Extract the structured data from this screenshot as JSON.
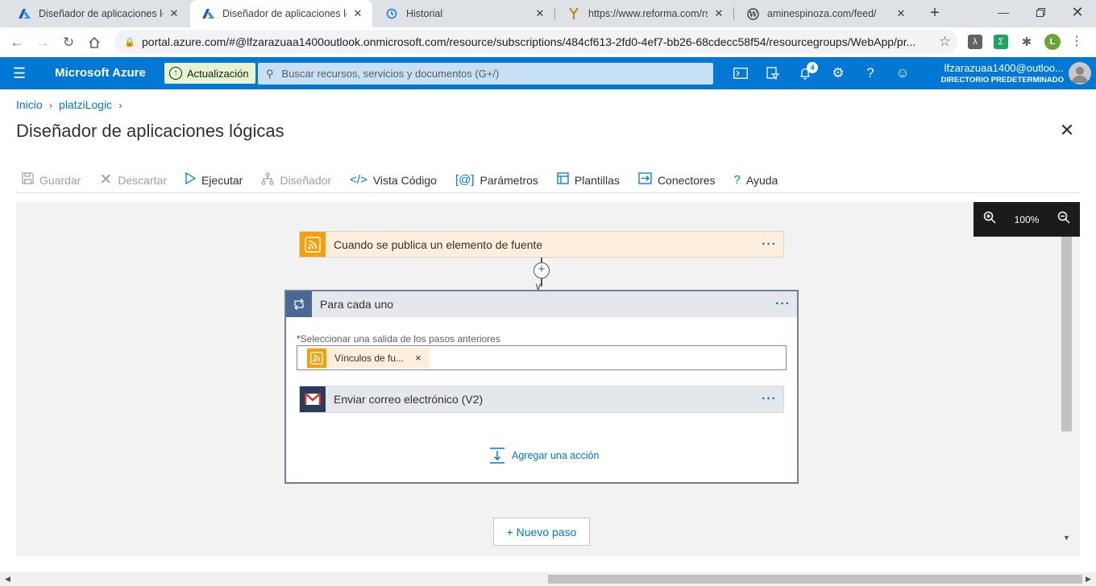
{
  "browser": {
    "tabs": [
      {
        "title": "Diseñador de aplicaciones lógicas",
        "icon": "azure-icon"
      },
      {
        "title": "Diseñador de aplicaciones lógicas",
        "icon": "azure-icon",
        "active": true
      },
      {
        "title": "Historial",
        "icon": "history-icon"
      },
      {
        "title": "https://www.reforma.com/rss/",
        "icon": "reforma-icon"
      },
      {
        "title": "aminespinoza.com/feed/",
        "icon": "wordpress-icon"
      }
    ],
    "close_glyph": "✕",
    "new_tab": "+",
    "url": "portal.azure.com/#@lfzarazuaa1400outlook.onmicrosoft.com/resource/subscriptions/484cf613-2fd0-4ef7-bb26-68cdecc58f54/resourcegroups/WebApp/pr...",
    "profile_initial": "L"
  },
  "azure": {
    "brand": "Microsoft Azure",
    "upgrade_label": "Actualización",
    "search_placeholder": "Buscar recursos, servicios y documentos (G+/)",
    "notifications_count": "4",
    "user_email": "lfzarazuaa1400@outloo...",
    "user_directory": "DIRECTORIO PREDETERMINADO"
  },
  "breadcrumb": [
    "Inicio",
    "platziLogic"
  ],
  "page_title": "Diseñador de aplicaciones lógicas",
  "commands": [
    {
      "label": "Guardar",
      "icon": "save-icon",
      "disabled": true
    },
    {
      "label": "Descartar",
      "icon": "discard-icon",
      "disabled": true
    },
    {
      "label": "Ejecutar",
      "icon": "run-icon",
      "disabled": false
    },
    {
      "label": "Diseñador",
      "icon": "designer-icon",
      "disabled": true
    },
    {
      "label": "Vista Código",
      "icon": "code-icon",
      "disabled": false
    },
    {
      "label": "Parámetros",
      "icon": "parameters-icon",
      "disabled": false
    },
    {
      "label": "Plantillas",
      "icon": "templates-icon",
      "disabled": false
    },
    {
      "label": "Conectores",
      "icon": "connectors-icon",
      "disabled": false
    },
    {
      "label": "Ayuda",
      "icon": "help-icon",
      "disabled": false
    }
  ],
  "canvas": {
    "zoom_level": "100%",
    "trigger_label": "Cuando se publica un elemento de fuente",
    "foreach_title": "Para cada uno",
    "foreach_field_label": "Seleccionar una salida de los pasos anteriores",
    "foreach_token": "Vínculos de fu...",
    "token_remove": "×",
    "action_label": "Enviar correo electrónico (V2)",
    "add_action": "Agregar una acción",
    "new_step": "+ Nuevo paso",
    "more_dots": "···"
  },
  "colors": {
    "azure_blue": "#0078d4",
    "rss_orange": "#f59f0b",
    "foreach_border": "#6f7f95"
  }
}
